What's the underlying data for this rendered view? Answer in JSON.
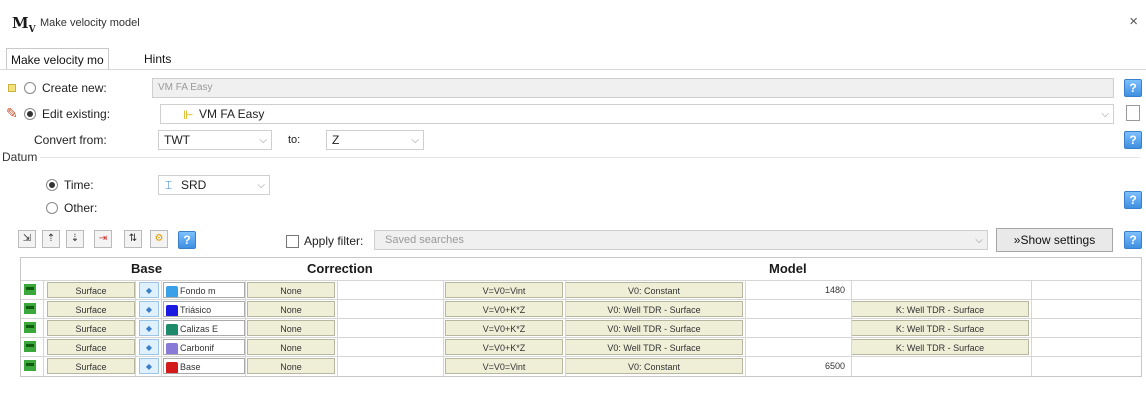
{
  "window": {
    "app_icon": "M",
    "app_icon_sub": "V",
    "title": "Make velocity model",
    "close": "×"
  },
  "tabs": [
    {
      "label": "Make velocity mo"
    },
    {
      "label": "Hints"
    }
  ],
  "create_new": {
    "label": "Create new:",
    "placeholder": "VM FA Easy"
  },
  "edit_existing": {
    "label": "Edit existing:",
    "value": "VM FA Easy"
  },
  "convert": {
    "from_label": "Convert from:",
    "from_value": "TWT",
    "to_label": "to:",
    "to_value": "Z"
  },
  "datum": {
    "label": "Datum",
    "time_label": "Time:",
    "time_value": "SRD",
    "other_label": "Other:"
  },
  "toolbar": {
    "apply_filter_label": "Apply filter:",
    "saved_searches": "Saved searches",
    "show_settings": "Show settings"
  },
  "help": "?",
  "grid": {
    "headers": {
      "base": "Base",
      "correction": "Correction",
      "model": "Model"
    },
    "rows": [
      {
        "base": "Surface",
        "horizon": "Fondo m",
        "color": "#3aa0e8",
        "correction": "None",
        "formula": "V=V0=Vint",
        "v0": "V0: Constant",
        "value": "1480",
        "k": ""
      },
      {
        "base": "Surface",
        "horizon": "Triásico",
        "color": "#1a1ae0",
        "correction": "None",
        "formula": "V=V0+K*Z",
        "v0": "V0: Well TDR - Surface",
        "value": "",
        "k": "K: Well TDR - Surface"
      },
      {
        "base": "Surface",
        "horizon": "Calizas E",
        "color": "#1e8a6a",
        "correction": "None",
        "formula": "V=V0+K*Z",
        "v0": "V0: Well TDR - Surface",
        "value": "",
        "k": "K: Well TDR - Surface"
      },
      {
        "base": "Surface",
        "horizon": "Carbonif",
        "color": "#8a7ad8",
        "correction": "None",
        "formula": "V=V0+K*Z",
        "v0": "V0: Well TDR - Surface",
        "value": "",
        "k": "K: Well TDR - Surface"
      },
      {
        "base": "Surface",
        "horizon": "Base",
        "color": "#d21a1a",
        "correction": "None",
        "formula": "V=V0=Vint",
        "v0": "V0: Constant",
        "value": "6500",
        "k": ""
      }
    ]
  }
}
